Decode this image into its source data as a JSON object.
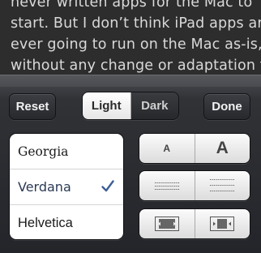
{
  "article": {
    "lines": [
      "never written apps for the Mac to",
      "start. But I don’t think iPad apps are",
      "ever going to run on the Mac as-is,",
      "without any change or adaptation to"
    ]
  },
  "toolbar": {
    "reset_label": "Reset",
    "done_label": "Done",
    "theme": {
      "options": [
        "Light",
        "Dark"
      ],
      "selected": "Light"
    }
  },
  "fonts": {
    "items": [
      "Georgia",
      "Verdana",
      "Helvetica"
    ],
    "selected": "Verdana"
  },
  "controls": {
    "font_size": {
      "smaller_label": "A",
      "larger_label": "A"
    },
    "line_spacing": {
      "icons": [
        "tight-line-spacing-icon",
        "loose-line-spacing-icon"
      ]
    },
    "margins": {
      "icons": [
        "narrow-margin-icon",
        "wide-margin-icon"
      ]
    }
  },
  "colors": {
    "checkmark": "#3e5f97",
    "panel": "#2b2d31",
    "article_bg": "#2d2d2d"
  }
}
